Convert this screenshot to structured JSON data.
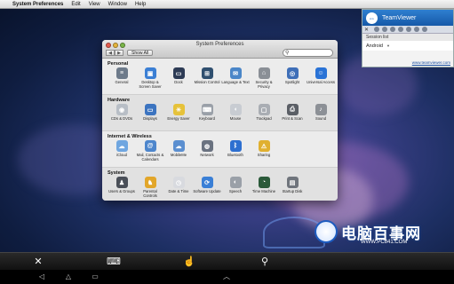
{
  "menubar": {
    "apple": "",
    "app_name": "System Preferences",
    "items": [
      "Edit",
      "View",
      "Window",
      "Help"
    ]
  },
  "prefs": {
    "title": "System Preferences",
    "back": "◀",
    "forward": "▶",
    "show_all": "Show All",
    "search_placeholder": "",
    "sections": [
      {
        "title": "Personal",
        "items": [
          {
            "label": "General",
            "icon": "general-icon",
            "color": "#6d7a8a",
            "glyph": "≡"
          },
          {
            "label": "Desktop & Screen Saver",
            "icon": "desktop-icon",
            "color": "#3b7fd4",
            "glyph": "▣"
          },
          {
            "label": "Dock",
            "icon": "dock-icon",
            "color": "#2d3b55",
            "glyph": "▭"
          },
          {
            "label": "Mission Control",
            "icon": "mission-control-icon",
            "color": "#2f4f6f",
            "glyph": "⊞"
          },
          {
            "label": "Language & Text",
            "icon": "language-icon",
            "color": "#4a86c8",
            "glyph": "✉"
          },
          {
            "label": "Security & Privacy",
            "icon": "security-icon",
            "color": "#8a8f96",
            "glyph": "⌂"
          },
          {
            "label": "Spotlight",
            "icon": "spotlight-icon",
            "color": "#3f6fb8",
            "glyph": "◎"
          },
          {
            "label": "Universal Access",
            "icon": "universal-access-icon",
            "color": "#2a73d6",
            "glyph": "☺"
          }
        ]
      },
      {
        "title": "Hardware",
        "items": [
          {
            "label": "CDs & DVDs",
            "icon": "cd-icon",
            "color": "#b8bec6",
            "glyph": "◉"
          },
          {
            "label": "Displays",
            "icon": "displays-icon",
            "color": "#3c74c0",
            "glyph": "▭"
          },
          {
            "label": "Energy Saver",
            "icon": "energy-saver-icon",
            "color": "#e6c23a",
            "glyph": "☀"
          },
          {
            "label": "Keyboard",
            "icon": "keyboard-icon",
            "color": "#9aa0a8",
            "glyph": "⌨"
          },
          {
            "label": "Mouse",
            "icon": "mouse-icon",
            "color": "#c8ccd2",
            "glyph": "◖"
          },
          {
            "label": "Trackpad",
            "icon": "trackpad-icon",
            "color": "#a9adb3",
            "glyph": "▢"
          },
          {
            "label": "Print & Scan",
            "icon": "printer-icon",
            "color": "#5b5f66",
            "glyph": "⎙"
          },
          {
            "label": "Sound",
            "icon": "sound-icon",
            "color": "#8c9096",
            "glyph": "♪"
          }
        ]
      },
      {
        "title": "Internet & Wireless",
        "items": [
          {
            "label": "iCloud",
            "icon": "icloud-icon",
            "color": "#6fa6e0",
            "glyph": "☁"
          },
          {
            "label": "Mail, Contacts & Calendars",
            "icon": "mail-icon",
            "color": "#4d86cc",
            "glyph": "@"
          },
          {
            "label": "MobileMe",
            "icon": "mobileme-icon",
            "color": "#5b8fd0",
            "glyph": "☁"
          },
          {
            "label": "Network",
            "icon": "network-icon",
            "color": "#6a7280",
            "glyph": "◍"
          },
          {
            "label": "Bluetooth",
            "icon": "bluetooth-icon",
            "color": "#2d6fd0",
            "glyph": "ᛒ"
          },
          {
            "label": "Sharing",
            "icon": "sharing-icon",
            "color": "#e0b030",
            "glyph": "⚠"
          }
        ]
      },
      {
        "title": "System",
        "items": [
          {
            "label": "Users & Groups",
            "icon": "users-icon",
            "color": "#4a4f58",
            "glyph": "♟"
          },
          {
            "label": "Parental Controls",
            "icon": "parental-controls-icon",
            "color": "#e2a62a",
            "glyph": "♞"
          },
          {
            "label": "Date & Time",
            "icon": "date-time-icon",
            "color": "#d8dadf",
            "glyph": "◷"
          },
          {
            "label": "Software Update",
            "icon": "software-update-icon",
            "color": "#3a7fd6",
            "glyph": "⟳"
          },
          {
            "label": "Speech",
            "icon": "speech-icon",
            "color": "#9aa0a8",
            "glyph": "◐"
          },
          {
            "label": "Time Machine",
            "icon": "time-machine-icon",
            "color": "#2b5a3a",
            "glyph": "◔"
          },
          {
            "label": "Startup Disk",
            "icon": "startup-disk-icon",
            "color": "#6f747c",
            "glyph": "▤"
          }
        ]
      }
    ]
  },
  "teamviewer": {
    "title": "TeamViewer",
    "logo_glyph": "⇔",
    "close": "✕",
    "session_list": "Session list",
    "session": "Android",
    "dropdown": "▼",
    "url": "www.teamviewer.com"
  },
  "watermark": {
    "cn": "电脑百事网",
    "url": "WWW.PC841.COM"
  },
  "toolbar": {
    "close": "✕",
    "keyboard": "⌨",
    "mouse": "☝",
    "zoom": "⚲"
  },
  "navbar": {
    "back": "◁",
    "home": "△",
    "recent": "▭",
    "up": "︿"
  }
}
